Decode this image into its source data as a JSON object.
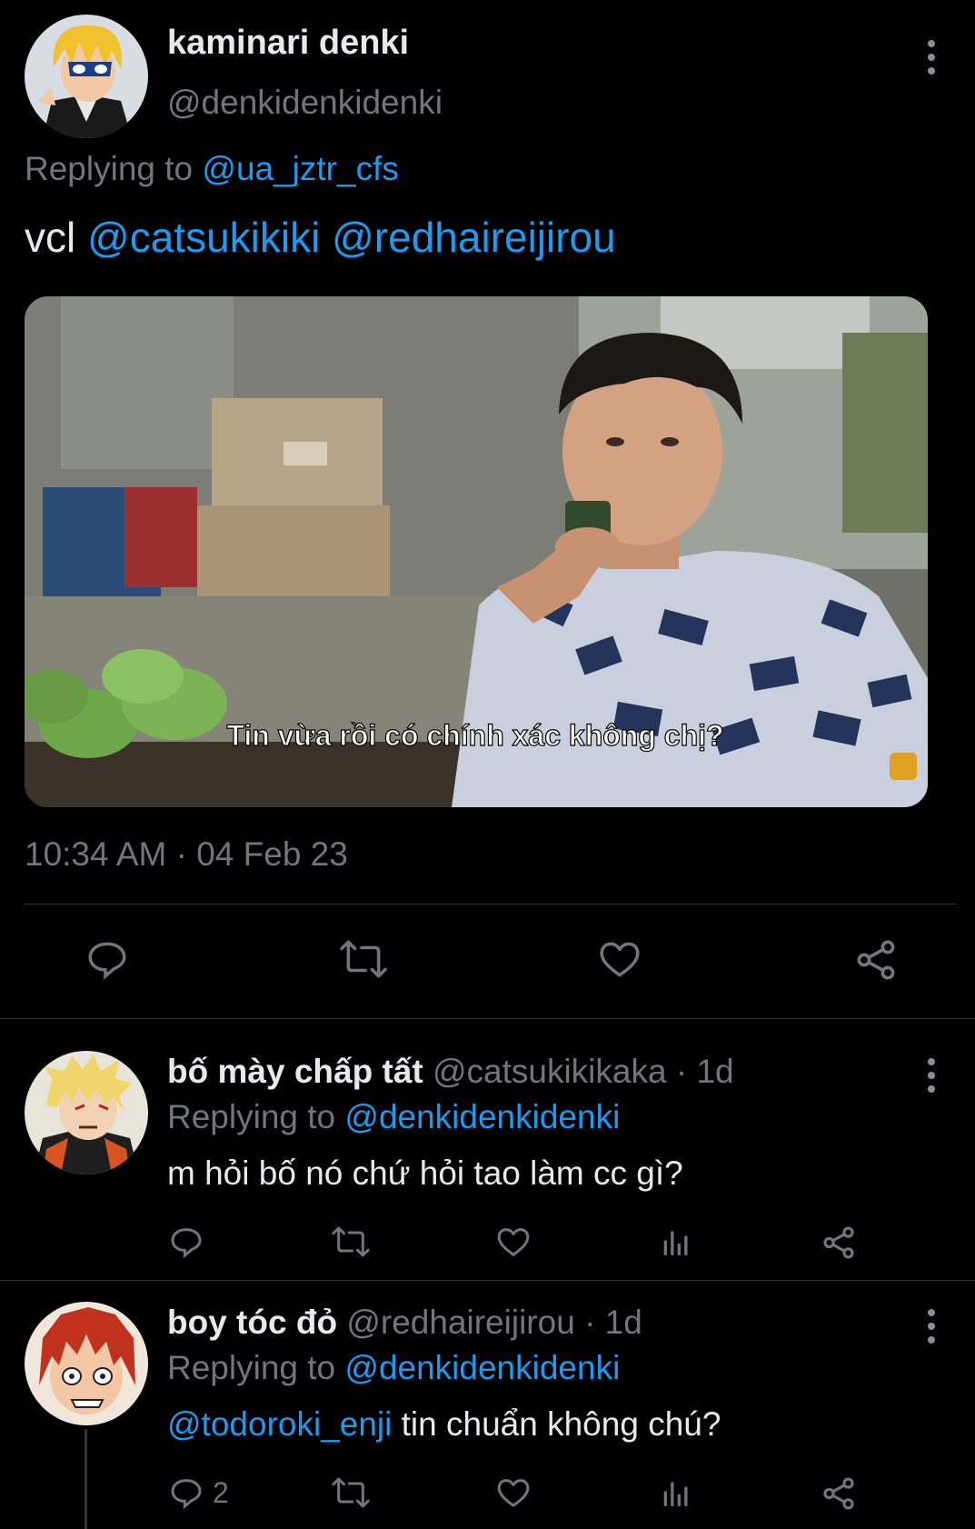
{
  "main_tweet": {
    "display_name": "kaminari denki",
    "handle": "@denkidenkidenki",
    "replying_prefix": "Replying to",
    "replying_handle": "@ua_jztr_cfs",
    "text_prefix": "vcl",
    "mention_1": "@catsukikiki",
    "mention_2": "@redhaireijirou",
    "media_caption": "Tin vừa rồi có chính xác không chị?",
    "timestamp": "10:34 AM · 04 Feb 23",
    "actions": [
      "reply-icon",
      "retweet-icon",
      "like-icon",
      "share-icon"
    ]
  },
  "replies": [
    {
      "display_name": "bố mày chấp tất",
      "handle": "@catsukikikaka",
      "age": "· 1d",
      "replying_prefix": "Replying to",
      "replying_handle": "@denkidenkidenki",
      "mention": "",
      "text": "m hỏi bố nó chứ hỏi tao làm cc gì?",
      "reply_count": ""
    },
    {
      "display_name": "boy tóc đỏ",
      "handle": "@redhaireijirou",
      "age": "· 1d",
      "replying_prefix": "Replying to",
      "replying_handle": "@denkidenkidenki",
      "mention": "@todoroki_enji",
      "text": "tin chuẩn không chú?",
      "reply_count": "2"
    }
  ],
  "colors": {
    "background": "#000000",
    "link": "#1d9bf0",
    "secondary_text": "#71767b",
    "divider": "#2f3336"
  }
}
